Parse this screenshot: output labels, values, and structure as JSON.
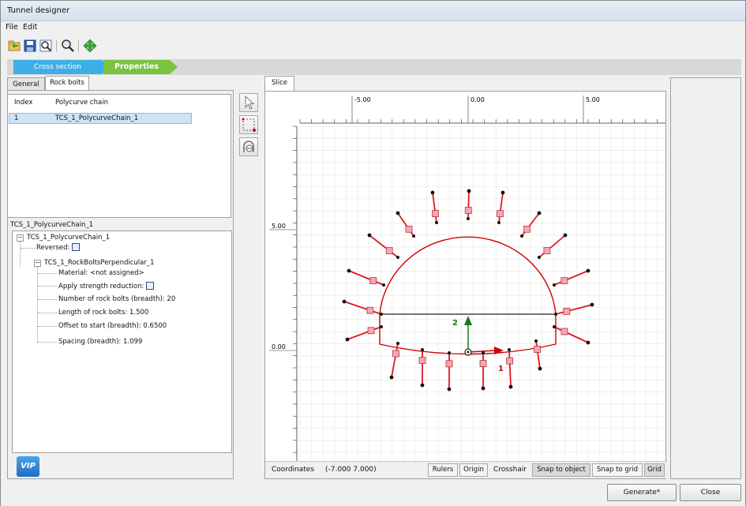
{
  "window": {
    "title": "Tunnel designer"
  },
  "menu": {
    "file": "File",
    "edit": "Edit"
  },
  "toolbar": {
    "icons": [
      "open-icon",
      "save-icon",
      "zoom-window-icon",
      "zoom-icon",
      "pan-icon"
    ]
  },
  "steps": {
    "cross_section": "Cross section",
    "properties": "Properties"
  },
  "left_tabs": {
    "general": "General",
    "rock_bolts": "Rock bolts"
  },
  "bolt_table": {
    "headers": [
      "Index",
      "Polycurve chain"
    ],
    "rows": [
      {
        "index": "1",
        "chain": "TCS_1_PolycurveChain_1"
      }
    ]
  },
  "props": {
    "group_label": "TCS_1_PolycurveChain_1",
    "root": "TCS_1_PolycurveChain_1",
    "reversed": "Reversed:",
    "node": "TCS_1_RockBoltsPerpendicular_1",
    "material": "Material: <not assigned>",
    "apply_strength": "Apply strength reduction:",
    "number_bolts": "Number of rock bolts (breadth): 20",
    "length_bolts": "Length of rock bolts: 1.500",
    "offset": "Offset to start (breadth): 0.6500",
    "spacing": "Spacing (breadth): 1.099"
  },
  "vip_label": "VIP",
  "slice_tab": "Slice",
  "canvas": {
    "top_ruler": [
      "-5.00",
      "0.00",
      "5.00"
    ],
    "left_ruler": [
      "5.00",
      "0.00"
    ],
    "axis_labels": {
      "one": "1",
      "two": "2"
    },
    "colors": {
      "tunnel": "#d40000",
      "bolt": "#e2171e",
      "anchor": "#f4a6b6",
      "axis2": "#1a7a1a",
      "axis1": "#cc0000"
    }
  },
  "status": {
    "coordinates_label": "Coordinates",
    "coordinates_value": "(-7.000 7.000)",
    "rulers": "Rulers",
    "origin": "Origin",
    "crosshair": "Crosshair",
    "snap_object": "Snap to object",
    "snap_grid": "Snap to grid",
    "grid": "Grid"
  },
  "buttons": {
    "generate": "Generate*",
    "close": "Close"
  }
}
